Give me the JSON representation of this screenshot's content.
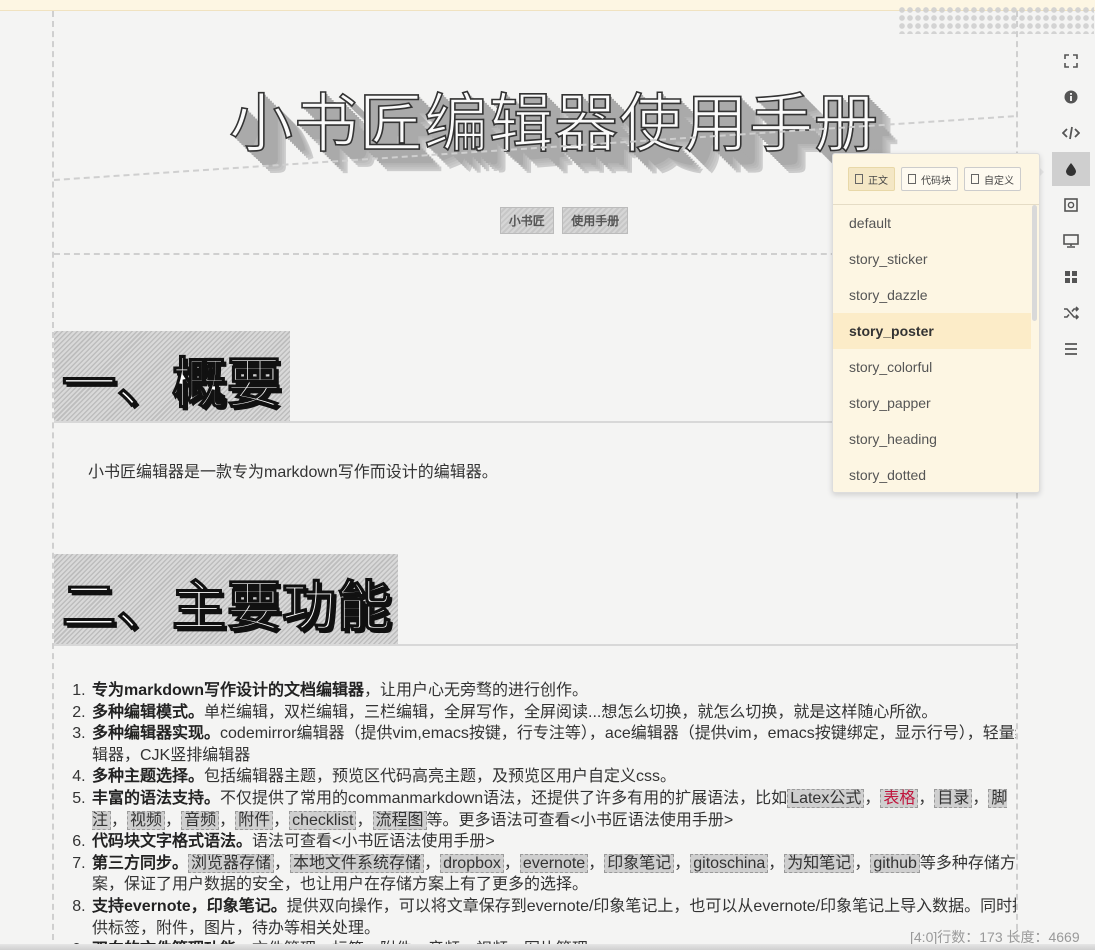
{
  "document": {
    "title": "小书匠编辑器使用手册",
    "tags": [
      "小书匠",
      "使用手册"
    ],
    "section1": {
      "heading": "一、概要",
      "paragraph": "小书匠编辑器是一款专为markdown写作而设计的编辑器。"
    },
    "section2": {
      "heading": "二、主要功能",
      "features": [
        {
          "bold": "专为markdown写作设计的文档编辑器",
          "text": "，让用户心无旁骛的进行创作。"
        },
        {
          "bold": "多种编辑模式。",
          "text": "单栏编辑，双栏编辑，三栏编辑，全屏写作，全屏阅读...想怎么切换，就怎么切换，就是这样随心所欲。"
        },
        {
          "bold": "多种编辑器实现。",
          "text": "codemirror编辑器（提供vim,emacs按键，行专注等），ace编辑器（提供vim，emacs按键绑定，显示行号），轻量编辑器，CJK竖排编辑器"
        },
        {
          "bold": "多种主题选择。",
          "text": "包括编辑器主题，预览区代码高亮主题，及预览区用户自定义css。"
        },
        {
          "bold": "丰富的语法支持。",
          "text_before": "不仅提供了常用的commanmarkdown语法，还提供了许多有用的扩展语法，比如",
          "tags": [
            "Latex公式",
            "表格",
            "目录",
            "脚注",
            "视频",
            "音频",
            "附件",
            "checklist",
            "流程图"
          ],
          "text_after": "等。更多语法可查看<小书匠语法使用手册>"
        },
        {
          "bold": "代码块文字格式语法。",
          "text": "语法可查看<小书匠语法使用手册>"
        },
        {
          "bold": "第三方同步。",
          "tags": [
            "浏览器存储",
            "本地文件系统存储",
            "dropbox",
            "evernote",
            "印象笔记",
            "gitoschina",
            "为知笔记",
            "github"
          ],
          "text_after": "等多种存储方案，保证了用户数据的安全，也让用户在存储方案上有了更多的选择。"
        },
        {
          "bold": "支持evernote，印象笔记。",
          "text": "提供双向操作，可以将文章保存到evernote/印象笔记上，也可以从evernote/印象笔记上导入数据。同时提供标签，附件，图片，待办等相关处理。"
        },
        {
          "bold": "双向的文件管理功能。",
          "text": "文件管理，标签，附件，音频，视频，图片管理"
        }
      ]
    }
  },
  "status_bar": {
    "text": "[4:0]行数：173 长度：4669"
  },
  "toolbar": {
    "icons": [
      "fullscreen-icon",
      "info-icon",
      "code-icon",
      "theme-drop-icon",
      "preview-icon",
      "monitor-icon",
      "grid-icon",
      "shuffle-icon",
      "menu-icon"
    ],
    "active": "theme-drop-icon"
  },
  "theme_popup": {
    "tabs": [
      {
        "label": "正文",
        "selected": true
      },
      {
        "label": "代码块",
        "selected": false
      },
      {
        "label": "自定义",
        "selected": false
      }
    ],
    "items": [
      "default",
      "story_sticker",
      "story_dazzle",
      "story_poster",
      "story_colorful",
      "story_papper",
      "story_heading",
      "story_dotted"
    ],
    "selected": "story_poster",
    "scroll_fraction_visible": 0.4
  },
  "colors": {
    "accent_selected": "#fcecc8",
    "popup_bg": "#fdf6e3",
    "table_tag_red": "#c0143c"
  }
}
